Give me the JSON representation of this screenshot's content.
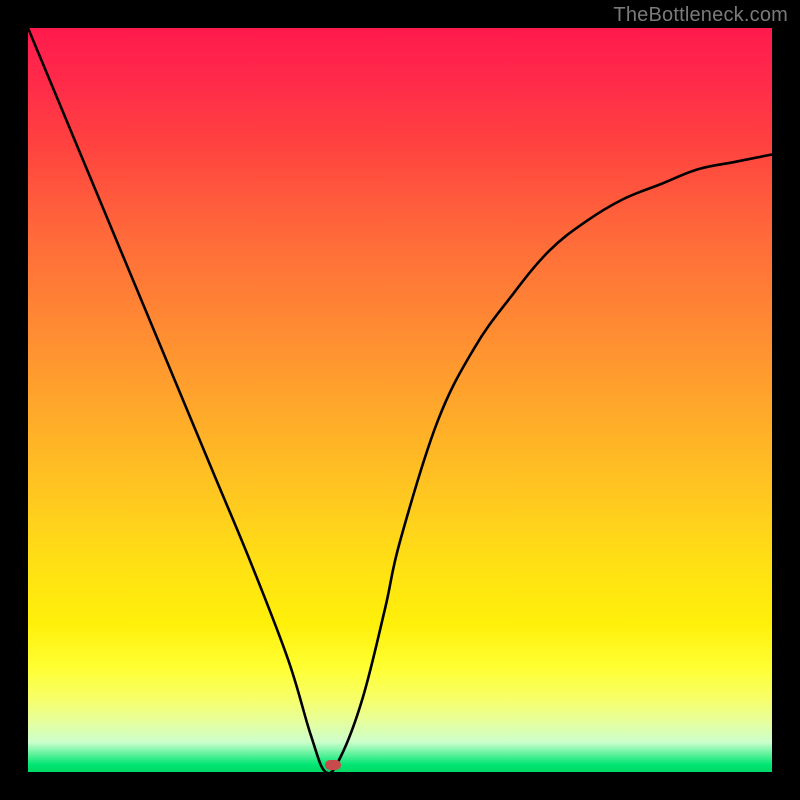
{
  "watermark": "TheBottleneck.com",
  "chart_data": {
    "type": "line",
    "title": "",
    "xlabel": "",
    "ylabel": "",
    "xlim": [
      0,
      100
    ],
    "ylim": [
      0,
      100
    ],
    "series": [
      {
        "name": "curve",
        "x": [
          0,
          5,
          10,
          15,
          20,
          25,
          30,
          35,
          38,
          40,
          42,
          45,
          48,
          50,
          55,
          60,
          65,
          70,
          75,
          80,
          85,
          90,
          95,
          100
        ],
        "values": [
          100,
          88,
          76,
          64,
          52,
          40,
          28,
          15,
          5,
          0,
          2,
          10,
          22,
          31,
          47,
          57,
          64,
          70,
          74,
          77,
          79,
          81,
          82,
          83
        ]
      }
    ],
    "marker": {
      "x": 41,
      "y": 1
    },
    "gradient_stops": [
      {
        "pos": 0,
        "color": "#ff1a4d"
      },
      {
        "pos": 50,
        "color": "#ffaa2a"
      },
      {
        "pos": 85,
        "color": "#ffff33"
      },
      {
        "pos": 100,
        "color": "#00d966"
      }
    ]
  }
}
